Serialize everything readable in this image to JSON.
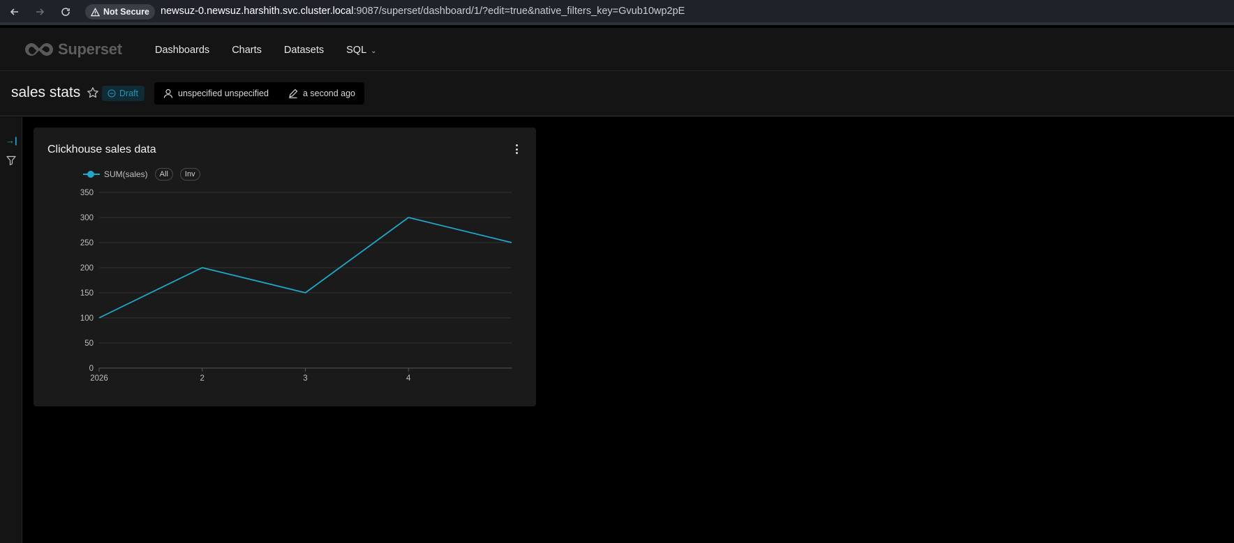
{
  "browser": {
    "security_label": "Not Secure",
    "url_host": "newsuz-0.newsuz.harshith.svc.cluster.local",
    "url_path": ":9087/superset/dashboard/1/?edit=true&native_filters_key=Gvub10wp2pE"
  },
  "app": {
    "logo_text": "Superset",
    "menu": [
      "Dashboards",
      "Charts",
      "Datasets",
      "SQL"
    ]
  },
  "dashboard": {
    "title": "sales stats",
    "status": "Draft",
    "owner": "unspecified unspecified",
    "modified": "a second ago"
  },
  "chart_card": {
    "title": "Clickhouse sales data",
    "legend_all": "All",
    "legend_inv": "Inv"
  },
  "colors": {
    "series": "#1fa8c9",
    "accent": "#20a7c9"
  },
  "chart_data": {
    "type": "line",
    "title": "Clickhouse sales data",
    "xlabel": "",
    "ylabel": "",
    "x_ticks": [
      "2026",
      "2",
      "3",
      "4"
    ],
    "y_ticks": [
      0,
      50,
      100,
      150,
      200,
      250,
      300,
      350
    ],
    "ylim": [
      0,
      350
    ],
    "grid": true,
    "legend_position": "top-left",
    "series": [
      {
        "name": "SUM(sales)",
        "x": [
          1,
          2,
          3,
          4,
          5
        ],
        "values": [
          100,
          200,
          150,
          300,
          250
        ]
      }
    ]
  }
}
